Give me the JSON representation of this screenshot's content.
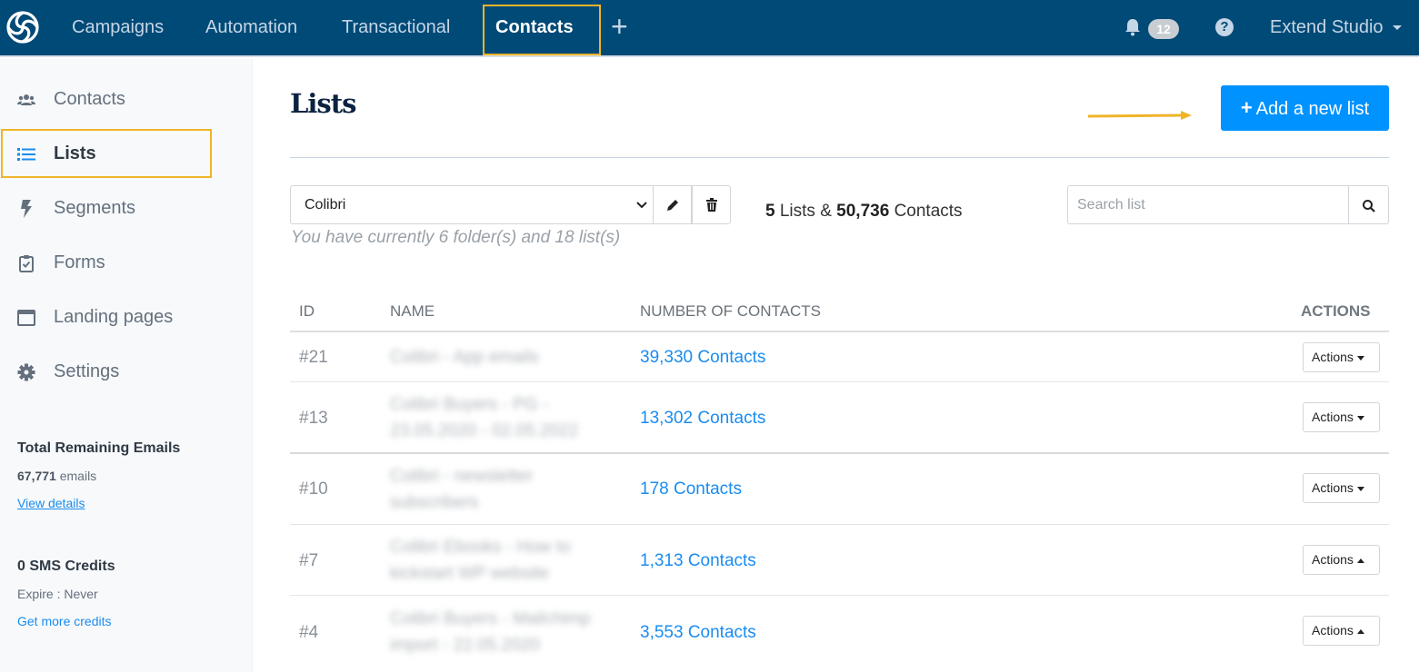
{
  "topbar": {
    "nav": [
      {
        "label": "Campaigns",
        "active": false
      },
      {
        "label": "Automation",
        "active": false
      },
      {
        "label": "Transactional",
        "active": false
      },
      {
        "label": "Contacts",
        "active": true
      }
    ],
    "add_icon": "+",
    "notifications_count": "12",
    "help_icon": "?",
    "account_name": "Extend Studio"
  },
  "sidebar": {
    "items": [
      {
        "label": "Contacts",
        "icon": "users-icon",
        "active": false
      },
      {
        "label": "Lists",
        "icon": "list-icon",
        "active": true
      },
      {
        "label": "Segments",
        "icon": "bolt-icon",
        "active": false
      },
      {
        "label": "Forms",
        "icon": "clipboard-check-icon",
        "active": false
      },
      {
        "label": "Landing pages",
        "icon": "browser-window-icon",
        "active": false
      },
      {
        "label": "Settings",
        "icon": "gear-icon",
        "active": false
      }
    ],
    "emails": {
      "title": "Total Remaining Emails",
      "count": "67,771",
      "unit": "emails",
      "link": "View details"
    },
    "sms": {
      "title": "0 SMS Credits",
      "expire": "Expire : Never",
      "link": "Get more credits"
    }
  },
  "main": {
    "title": "Lists",
    "add_button": "Add a new list",
    "folder": {
      "selected": "Colibri",
      "note": "You have currently 6 folder(s) and 18 list(s)"
    },
    "summary": {
      "lists_count": "5",
      "lists_label": "Lists &",
      "contacts_count": "50,736",
      "contacts_label": "Contacts"
    },
    "search": {
      "placeholder": "Search list",
      "value": ""
    },
    "table": {
      "headers": {
        "id": "ID",
        "name": "NAME",
        "count": "NUMBER OF CONTACTS",
        "actions": "ACTIONS"
      },
      "rows": [
        {
          "id": "#21",
          "name": "Colibri - App emails",
          "count": "39,330 Contacts",
          "action": "Actions",
          "caret": "down"
        },
        {
          "id": "#13",
          "name": "Colibri Buyers - PG - 23.05.2020 - 02.05.2022",
          "count": "13,302 Contacts",
          "action": "Actions",
          "caret": "down"
        },
        {
          "id": "#10",
          "name": "Colibri - newsletter subscribers",
          "count": "178 Contacts",
          "action": "Actions",
          "caret": "down"
        },
        {
          "id": "#7",
          "name": "Colibri Ebooks - How to kickstart WP website",
          "count": "1,313 Contacts",
          "action": "Actions",
          "caret": "up"
        },
        {
          "id": "#4",
          "name": "Colibri Buyers - Mailchimp import - 22.05.2020",
          "count": "3,553 Contacts",
          "action": "Actions",
          "caret": "up"
        }
      ]
    }
  },
  "colors": {
    "topbar": "#004a77",
    "primary": "#0092ff",
    "link": "#1a8cf0",
    "highlight": "#f0b429"
  }
}
